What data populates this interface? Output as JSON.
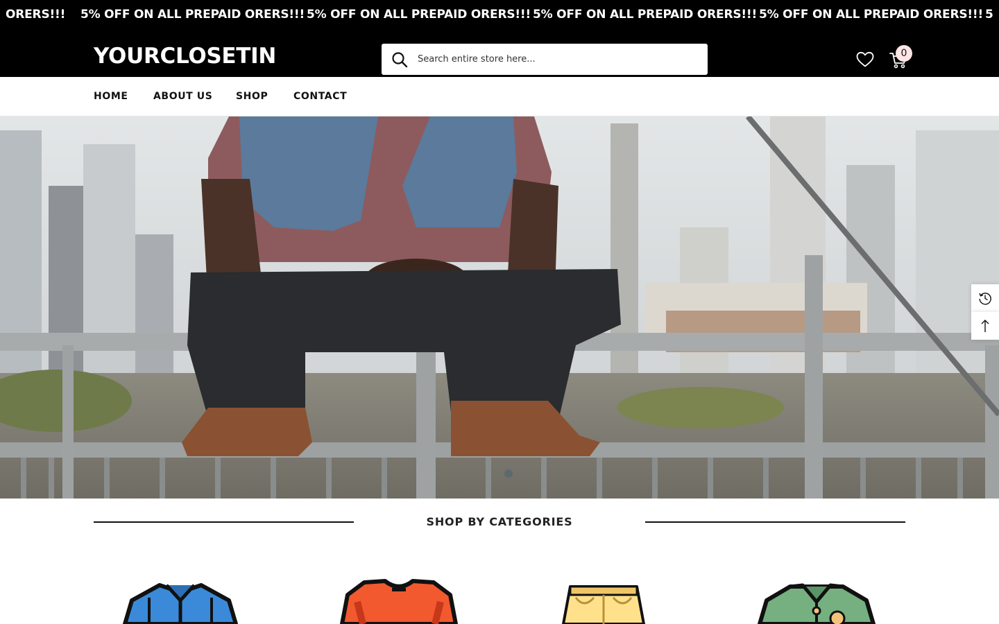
{
  "announcement": {
    "text": "5% OFF ON ALL PREPAID ORERS!!!",
    "partial_left": "ORERS!!!",
    "partial_right": "5"
  },
  "header": {
    "logo": "YOURCLOSETIN",
    "search_placeholder": "Search entire store here...",
    "cart_count": "0",
    "icons": [
      "search-icon",
      "heart-icon",
      "cart-icon"
    ]
  },
  "nav": {
    "items": [
      {
        "label": "HOME"
      },
      {
        "label": "ABOUT US"
      },
      {
        "label": "SHOP"
      },
      {
        "label": "CONTACT"
      }
    ]
  },
  "hero": {
    "slide_count": 1,
    "active_slide": 1
  },
  "side_tools": [
    "recently-viewed-icon",
    "back-to-top-icon"
  ],
  "categories": {
    "title": "SHOP BY CATEGORIES",
    "items": [
      {
        "icon": "shirt-icon",
        "color": "#3a8ad9"
      },
      {
        "icon": "tshirt-icon",
        "color": "#f2592f"
      },
      {
        "icon": "shorts-icon",
        "color": "#ffe18c"
      },
      {
        "icon": "jacket-icon",
        "color": "#76b080"
      }
    ]
  }
}
